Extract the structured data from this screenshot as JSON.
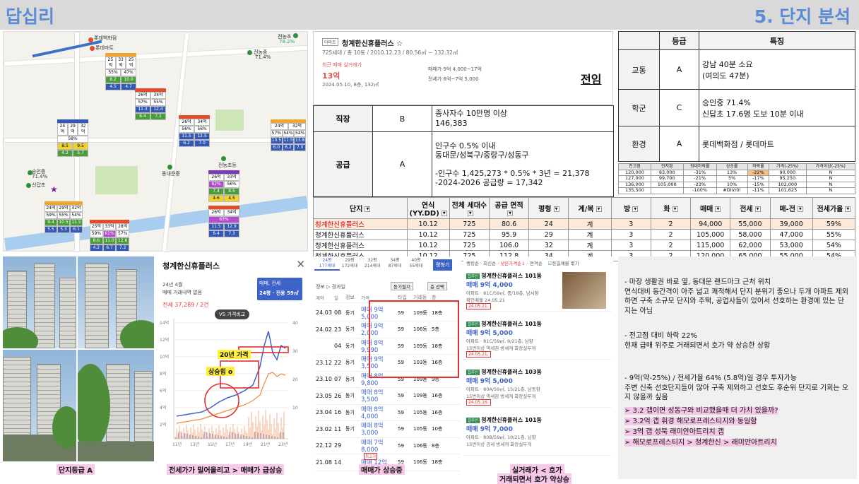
{
  "header": {
    "left": "답십리",
    "right": "5. 단지 분석"
  },
  "map": {
    "labels": [
      "롯데백화점",
      "롯데마트",
      "전농초",
      "78.2%",
      "전농중",
      "71.4%",
      "답십리중",
      "동대문중",
      "전농초등",
      "용두중",
      "전농초등",
      "신답초"
    ],
    "top_labels": {
      "a": "롯데백화점",
      "b": "롯데마트",
      "c": "전농초",
      "c_rate": "78.2%",
      "d": "전농중",
      "d_rate": "71.4%"
    },
    "labels_mid": {
      "e": "승인중",
      "e_rate": "71.4%",
      "f": "신답초",
      "g": "동대문중",
      "h": "전농초등"
    },
    "markers": [
      {
        "head": "",
        "r1": [
          "25억",
          "33억",
          "25억"
        ],
        "r2": [
          "55%",
          "47%",
          "12%"
        ],
        "r3": [
          "8.2",
          "10.0",
          "10.0"
        ],
        "r4": [
          "4.5",
          "4.7",
          "4.0"
        ]
      },
      {
        "head": "",
        "r1": [
          "26억",
          "34억",
          ""
        ],
        "r2": [
          "57%",
          "55%",
          ""
        ],
        "r3": [
          "11.3",
          "12.4",
          ""
        ],
        "r4": [
          "6.4",
          "7.1",
          ""
        ]
      },
      {
        "head": "",
        "r1": [
          "24억",
          "29억",
          "32억"
        ],
        "r2": [
          "58%",
          "",
          ""
        ],
        "r3": [
          "8.5",
          "9.5",
          ""
        ],
        "r4": [
          "4.2",
          "5.7",
          ""
        ]
      },
      {
        "head": "",
        "r1": [
          "26억",
          "34억",
          ""
        ],
        "r2": [
          "56%",
          "56%",
          ""
        ],
        "r3": [
          "11.5",
          "12.5",
          ""
        ],
        "r4": [
          "6.2",
          "7.0",
          ""
        ]
      },
      {
        "head": "",
        "r1": [
          "24억",
          "32억",
          ""
        ],
        "r2": [
          "57%",
          "54%",
          "54%"
        ],
        "r3": [
          "10.5",
          "11.5",
          "13.8"
        ],
        "r4": [
          "6.0",
          "6.2",
          "7.0"
        ]
      },
      {
        "head": "",
        "r1": [
          "26억",
          "33억",
          ""
        ],
        "r2": [
          "62%",
          "56%",
          ""
        ],
        "r3": [
          "7.4",
          "8.5",
          ""
        ],
        "r4": [
          "4.6",
          "4.5",
          ""
        ]
      },
      {
        "head": "",
        "r1": [
          "24억",
          "29억",
          "32억"
        ],
        "r2": [
          "59%",
          "55%",
          "54%"
        ],
        "r3": [
          "9.4",
          "10.5",
          "11.5"
        ],
        "r4": [
          "5.5",
          "5.3",
          "6.1"
        ]
      },
      {
        "head": "",
        "r1": [
          "26억",
          "34억",
          ""
        ],
        "r2": [
          "63%",
          "",
          ""
        ],
        "r3": [
          "11.5",
          "12.9",
          ""
        ],
        "r4": [
          "6.4",
          "7.3",
          ""
        ]
      },
      {
        "head": "",
        "r1": [
          "25억",
          "33억",
          "28억"
        ],
        "r2": [
          "59%",
          "61%",
          "57%"
        ],
        "r3": [
          "8.6",
          "11.0",
          "12.6"
        ],
        "r4": [
          "4.2",
          "6.7",
          "7.2"
        ]
      }
    ]
  },
  "card": {
    "badge": "아파트",
    "title": "청계한신휴플러스 ☆",
    "meta": "725세대 / 총 10동 / 2010.12.23 / 80.56㎡ ~ 132.32㎡",
    "recent_label": "최근 매매 실거래가",
    "price": "13억",
    "date": "2024.05.10, 8층, 132㎡",
    "sale_range": "매매가 9억 4,000~17억",
    "rent_range": "전세가 6억~7억 5,000",
    "jeonim": "전임"
  },
  "left_table": [
    {
      "cat": "직장",
      "grade": "B",
      "desc": "종사자수 10만명 이상\n146,383"
    },
    {
      "cat": "공급",
      "grade": "A",
      "desc": "인구수 0.5% 이내\n동대문/성북구/중랑구/성동구\n\n-인구수 1,425,273 * 0.5% * 3년 = 21,378\n-2024-2026 공급량 = 17,342"
    }
  ],
  "right_table": {
    "headers": [
      "",
      "등급",
      "특징"
    ],
    "rows": [
      {
        "cat": "교통",
        "grade": "A",
        "desc": "강남 40분 소요\n(여의도 47분)"
      },
      {
        "cat": "학군",
        "grade": "C",
        "desc": "승인중 71.4%\n신답초 17.6명 도보 10분 이내"
      },
      {
        "cat": "환경",
        "grade": "A",
        "desc": "롯데백화점 / 롯데마트"
      }
    ]
  },
  "small_table": {
    "headers": [
      "전고점",
      "전저점",
      "최대하락률",
      "상승률",
      "하락률",
      "가격(-25%)",
      "가격이상(-25%)"
    ],
    "rows": [
      [
        "120,000",
        "83,000",
        "-31%",
        "13%",
        "-22%",
        "90,000",
        "N"
      ],
      [
        "127,000",
        "99,700",
        "-21%",
        "5%",
        "-17%",
        "95,250",
        "N"
      ],
      [
        "136,000",
        "105,000",
        "-23%",
        "10%",
        "-15%",
        "102,000",
        "N"
      ],
      [
        "135,500",
        "",
        "-100%",
        "#DIV/0!",
        "-11%",
        "101,625",
        "N"
      ]
    ]
  },
  "main_table": {
    "headers": [
      "단지",
      "연식(YY.DD)",
      "전체 세대수",
      "공급 면적",
      "평형",
      "계/복",
      "방",
      "화",
      "매매",
      "전세",
      "매-전",
      "전세가율"
    ],
    "rows": [
      [
        "청계한신휴플러스",
        "10.12",
        "725",
        "80.6",
        "24",
        "계",
        "3",
        "2",
        "94,000",
        "55,000",
        "39,000",
        "59%"
      ],
      [
        "청계한신휴플러스",
        "10.12",
        "725",
        "95.9",
        "29",
        "계",
        "3",
        "2",
        "105,000",
        "58,000",
        "47,000",
        "55%"
      ],
      [
        "청계한신휴플러스",
        "10.12",
        "725",
        "106.0",
        "32",
        "계",
        "3",
        "2",
        "115,000",
        "62,000",
        "53,000",
        "54%"
      ],
      [
        "청계한신휴플러스",
        "10.12",
        "725",
        "112.8",
        "34",
        "계",
        "3",
        "2",
        "120,000",
        "65,000",
        "55,000",
        "54%"
      ]
    ]
  },
  "chart": {
    "title": "청계한신휴플러스",
    "month": "24년 4월",
    "none": "매매 거래내역 없음",
    "summary": "전세 37,289 / 2건",
    "select": "매매, 전세",
    "select2": "24평 · 전용 59㎡",
    "vs": "VS 가격비교",
    "ann1": "20년 가격",
    "ann2": "상승힘 o",
    "y_left": [
      "14억",
      "12억",
      "10억",
      "8억",
      "6억",
      "4억",
      "2억"
    ],
    "y_right": [
      "40",
      "30",
      "20",
      "10"
    ],
    "x_ticks": [
      "11년",
      "13년",
      "15년",
      "17년",
      "19년",
      "21년",
      "23년"
    ]
  },
  "captions": {
    "c1": "단지등급 A",
    "c2": "전세가가 밀어올리고 > 매매가 급상승",
    "c3": "매매가 상승중",
    "c4a": "실거래가 < 호가",
    "c4b": "거래되면서 호가 약상승"
  },
  "tx": {
    "tabs": [
      [
        "24평",
        "177세대"
      ],
      [
        "29평",
        "172세대"
      ],
      [
        "32평",
        "214세대"
      ],
      [
        "34평",
        "87세대"
      ],
      [
        "40평",
        "55세대"
      ]
    ],
    "button": "평형기",
    "filter1": "정보 ▷ 경과일",
    "filter2": "동기필지",
    "filter3": "층 선택",
    "cols": [
      "계약",
      "일",
      "정보",
      "가격",
      "타입",
      "거래동",
      "층"
    ],
    "rows": [
      [
        "24.03",
        "08",
        "동기",
        "매매 9억 5,000",
        "59",
        "109동",
        "18층"
      ],
      [
        "24.02",
        "23",
        "동기",
        "매매 9억 2,000",
        "59",
        "106동",
        "5층"
      ],
      [
        "",
        "04",
        "동기",
        "매매 8억 9,990",
        "59",
        "109동",
        "18층"
      ],
      [
        "23.12",
        "22",
        "동기",
        "매매 9억 3,500",
        "59",
        "103동",
        "16층"
      ],
      [
        "23.10",
        "07",
        "동기",
        "매매 8억 9,800",
        "59",
        "109동",
        "9층"
      ],
      [
        "23.05",
        "26",
        "동기",
        "매매 8억 3,500",
        "59",
        "109동",
        "16층"
      ],
      [
        "23.04",
        "16",
        "동기",
        "매매 8억 4,000",
        "59",
        "105동",
        "16층"
      ],
      [
        "23.02",
        "11",
        "동기",
        "매매 8억 3,000",
        "59",
        "105동",
        "10층"
      ],
      [
        "22.12",
        "29",
        "",
        "매매 7억 8,000",
        "59",
        "106동",
        "8층"
      ],
      [
        "21.08",
        "14",
        "",
        "매매 12억",
        "59",
        "106동",
        "18층"
      ]
    ],
    "badge_last": "최고가"
  },
  "listings": {
    "top": [
      "랭킹순",
      "최신순",
      "낮은가격순↓",
      "면적순",
      "동일매물 묶기"
    ],
    "cards": [
      {
        "tag": "집주인",
        "name": "청계한신휴플러스 101동",
        "price": "매매 9억 4,000",
        "sub1": "아파트 · 81C/59㎡, 중/18층, 남서향",
        "sub2": "확인매물 24.05.21",
        "date": "24.05.21."
      },
      {
        "tag": "집주인",
        "name": "청계한신휴플러스 101동",
        "price": "매매 9억 5,000",
        "sub1": "아파트 · 81C/59㎡, 9/21층, 남향",
        "sub2": "15번이상 역세권 방세개 화장실두개",
        "date": "24.05.21."
      },
      {
        "tag": "집주인",
        "name": "청계한신휴플러스 103동",
        "price": "매매 9억 5,000",
        "sub1": "아파트 · 80A/59㎡, 15/21층, 남동향",
        "sub2": "15번이상 역세권 방세개 화장실두개",
        "date": "24.05.16."
      },
      {
        "tag": "집주인",
        "name": "청계한신휴플러스 101동",
        "price": "매매 9억 7,000",
        "sub1": "아파트 · 80B/59㎡, 10/21층, 남향",
        "sub2": "15번이상 공세 방세개 화장실두개",
        "date": ""
      }
    ]
  },
  "notes": {
    "p1": "-   마장 생활권 바로 옆, 동대문 랜드마크 근처 위치\n연식대비 동간격이 아주 넓고 쾌적해서 단지 분위기 좋으나 두개 아파트 제외하면 구축 소규모 단지와 주택, 공업사들이 있어서 선호하는 환경에 있는 단지는 아님",
    "p2": "-   전고점 대비 하락 22%\n현재 급매 위주로 거래되면서 호가 약 상승한 상황",
    "p3": "-   9억(약-25%) / 전세가율 64% (5.8억)일 경우 투자가능\n주변 신축 선호단지들이 많아 구축 제외하고 선호도 후순위 단지로 기회는 오지 않을까 싶음",
    "b1": "➢  3.2 갭이면 성동구와 비교했을때 더 가치 있을까?",
    "b2": "➢  3.2억 갭 휘경 해모로프레스티지와 동일함",
    "b3": "➢  3억 갭 성북 래미안아트리치 갭",
    "b4": "➢  해모로프레스티지 > 청계한신 > 래미안아트리치"
  }
}
